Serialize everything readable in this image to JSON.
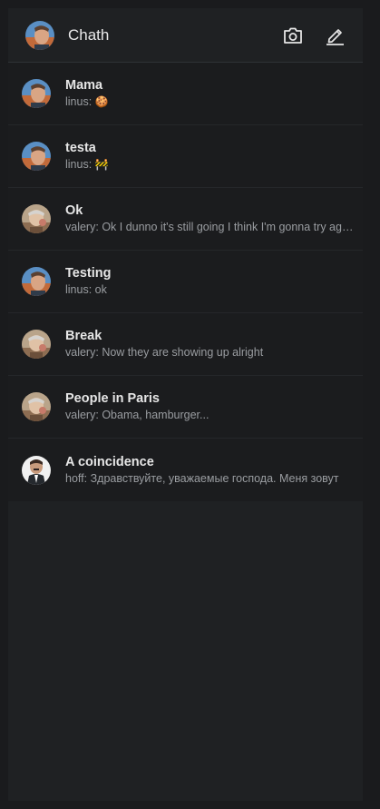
{
  "header": {
    "title": "Chath"
  },
  "chats": [
    {
      "name": "Mama",
      "sender": "linus:",
      "message": "",
      "emoji": "🍪",
      "avatar": "linus"
    },
    {
      "name": "testa",
      "sender": "linus:",
      "message": "",
      "emoji": "🚧",
      "avatar": "linus"
    },
    {
      "name": "Ok",
      "sender": "valery:",
      "message": "Ok I dunno it's still going I think I'm gonna try again",
      "emoji": "",
      "avatar": "valery"
    },
    {
      "name": "Testing",
      "sender": "linus:",
      "message": "ok",
      "emoji": "",
      "avatar": "linus"
    },
    {
      "name": "Break",
      "sender": "valery:",
      "message": "Now they are showing up alright",
      "emoji": "",
      "avatar": "valery"
    },
    {
      "name": "People in Paris",
      "sender": "valery:",
      "message": "Obama, hamburger...",
      "emoji": "",
      "avatar": "valery"
    },
    {
      "name": "A coincidence",
      "sender": "hoff:",
      "message": "Здравствуйте, уважаемые господа. Меня зовут",
      "emoji": "",
      "avatar": "hoff"
    }
  ]
}
